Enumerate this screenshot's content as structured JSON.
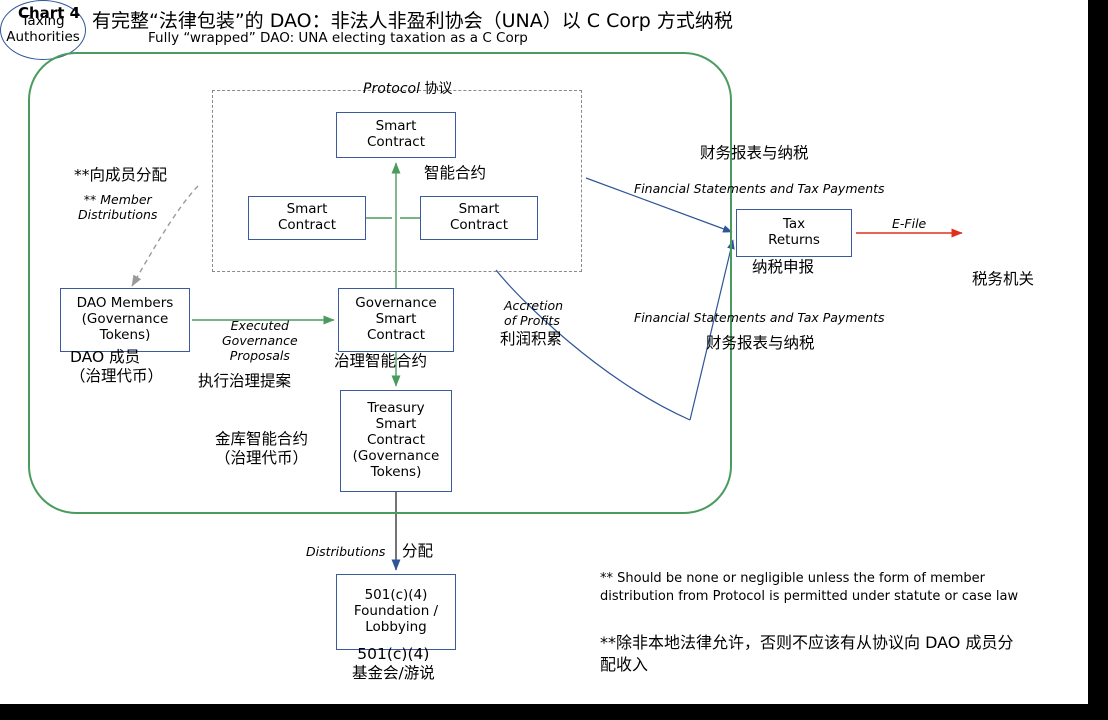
{
  "meta": {
    "chart_label": "Chart 4",
    "title_cn": "有完整“法律包装”的 DAO：非法人非盈利协会（UNA）以 C Corp 方式纳税",
    "title_en": "Fully “wrapped” DAO: UNA electing taxation as a C Corp"
  },
  "colors": {
    "wrapper_border": "#4a9b5e",
    "protocol_border": "#8a8a8a",
    "node_border": "#3a5a9b",
    "arrow_blue": "#2f5597",
    "arrow_green": "#4a9b5e",
    "arrow_red": "#e03020",
    "arrow_gray": "#9a9a9a"
  },
  "protocol": {
    "label_en": "Protocol",
    "label_cn": "协议"
  },
  "nodes": {
    "smart_contract_top": {
      "lines": [
        "Smart",
        "Contract"
      ]
    },
    "smart_contract_left": {
      "lines": [
        "Smart",
        "Contract"
      ]
    },
    "smart_contract_right": {
      "lines": [
        "Smart",
        "Contract"
      ]
    },
    "smart_contract_cn": "智能合约",
    "dao_members": {
      "lines": [
        "DAO Members",
        "(Governance",
        "Tokens)"
      ],
      "cn": "DAO 成员\n（治理代币）"
    },
    "governance": {
      "lines": [
        "Governance",
        "Smart",
        "Contract"
      ],
      "cn": "治理智能合约"
    },
    "treasury": {
      "lines": [
        "Treasury",
        "Smart",
        "Contract",
        "(Governance",
        "Tokens)"
      ],
      "cn": "金库智能合约\n（治理代币）"
    },
    "foundation": {
      "lines": [
        "501(c)(4)",
        "Foundation /",
        "Lobbying"
      ],
      "cn": "501(c)(4)\n基金会/游说"
    },
    "tax_returns": {
      "lines": [
        "Tax",
        "Returns"
      ],
      "cn": "纳税申报"
    },
    "taxing_authorities": {
      "lines": [
        "Taxing",
        "Authorities"
      ],
      "cn": "税务机关"
    }
  },
  "edges": {
    "member_distributions_en": "** Member\nDistributions",
    "member_distributions_cn": "**向成员分配",
    "executed_governance_en": "Executed\nGovernance\nProposals",
    "executed_governance_cn": "执行治理提案",
    "accretion_en": "Accretion\nof Profits",
    "accretion_cn": "利润积累",
    "financial_statements_en": "Financial Statements and Tax Payments",
    "financial_statements_cn": "财务报表与纳税",
    "financial_statements_en_2": "Financial Statements and Tax Payments",
    "financial_statements_cn_2": "财务报表与纳税",
    "efile_en": "E-File",
    "distributions_en": "Distributions",
    "distributions_cn": "分配"
  },
  "footnote": {
    "en": "** Should be none or negligible unless the form of member distribution from Protocol is permitted under statute or case law",
    "cn": "**除非本地法律允许，否则不应该有从协议向 DAO 成员分配收入"
  }
}
